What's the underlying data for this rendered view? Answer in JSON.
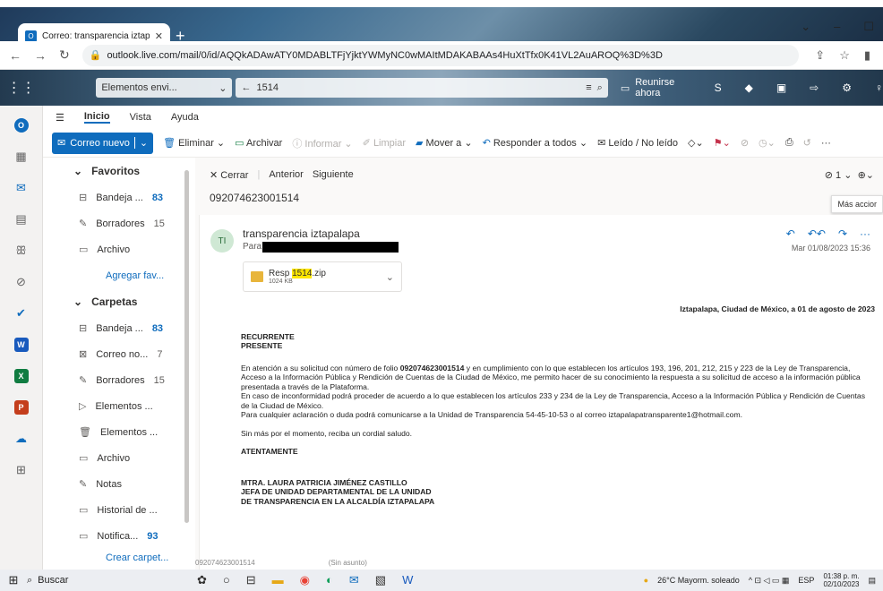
{
  "browser": {
    "tab_title": "Correo: transparencia iztapalapa",
    "url": "outlook.live.com/mail/0/id/AQQkADAwATY0MDABLTFjYjktYWMyNC0wMAItMDAKABAAs4HuXtTfx0K41VL2AuAROQ%3D%3D"
  },
  "header": {
    "folder": "Elementos envi...",
    "search": "1514",
    "meet": "Reunirse ahora"
  },
  "ribbon": {
    "tabs": [
      "Inicio",
      "Vista",
      "Ayuda"
    ],
    "new_mail": "Correo nuevo",
    "delete": "Eliminar",
    "archive": "Archivar",
    "report": "Informar",
    "sweep": "Limpiar",
    "move": "Mover a",
    "reply_all": "Responder a todos",
    "read_unread": "Leído / No leído"
  },
  "folders": {
    "favorites_header": "Favoritos",
    "favorites": [
      {
        "label": "Bandeja ...",
        "count": "83",
        "unread": true
      },
      {
        "label": "Borradores",
        "count": "15",
        "unread": false
      },
      {
        "label": "Archivo",
        "count": "",
        "unread": false
      }
    ],
    "add_favorite": "Agregar fav...",
    "folders_header": "Carpetas",
    "items": [
      {
        "label": "Bandeja ...",
        "count": "83",
        "unread": true
      },
      {
        "label": "Correo no...",
        "count": "7",
        "unread": false
      },
      {
        "label": "Borradores",
        "count": "15",
        "unread": false
      },
      {
        "label": "Elementos ...",
        "count": "",
        "unread": false
      },
      {
        "label": "Elementos ...",
        "count": "",
        "unread": false
      },
      {
        "label": "Archivo",
        "count": "",
        "unread": false
      },
      {
        "label": "Notas",
        "count": "",
        "unread": false
      },
      {
        "label": "Historial de ...",
        "count": "",
        "unread": false
      },
      {
        "label": "Notifica...",
        "count": "93",
        "unread": true
      }
    ],
    "create_folder": "Crear carpet..."
  },
  "reading": {
    "close": "Cerrar",
    "previous": "Anterior",
    "next": "Siguiente",
    "subject": "092074623001514",
    "attach_count": "1",
    "tooltip": "Más accior",
    "sender_initials": "TI",
    "sender": "transparencia iztapalapa",
    "to_label": "Para:",
    "date": "Mar 01/08/2023 15:36",
    "attachment": {
      "prefix": "Resp ",
      "highlight": "1514",
      "suffix": ".zip",
      "size": "1024 KB"
    }
  },
  "email": {
    "place_date": "Iztapalapa, Ciudad de México, a 01 de agosto de 2023",
    "recipient1": "RECURRENTE",
    "recipient2": "PRESENTE",
    "p1a": "En atención a su solicitud con número de folio ",
    "folio": "092074623001514",
    "p1b": " y en cumplimiento con lo que establecen los artículos 193, 196, 201, 212, 215 y 223 de la Ley de Transparencia, Acceso a la Información Pública y Rendición de Cuentas de la Ciudad de México, me permito hacer de su conocimiento la respuesta a su solicitud de acceso a la información pública presentada a través de la Plataforma.",
    "p2": "En caso de inconformidad podrá proceder de acuerdo a lo que establecen los artículos 233 y 234 de la Ley de Transparencia, Acceso a la Información Pública y Rendición de Cuentas de la Ciudad de México.",
    "p3": "Para cualquier aclaración o duda podrá comunicarse a la Unidad de Transparencia 54-45-10-53 o al correo iztapalapatransparente1@hotmail.com.",
    "closing": "Sin más por el momento, reciba un cordial saludo.",
    "regards": "ATENTAMENTE",
    "sig1": "MTRA. LAURA PATRICIA JIMÉNEZ CASTILLO",
    "sig2": "JEFA DE UNIDAD DEPARTAMENTAL DE LA UNIDAD",
    "sig3": "DE TRANSPARENCIA EN LA ALCALDÍA IZTAPALAPA"
  },
  "bottom_tabs": [
    "092074623001514",
    "(Sin asunto)"
  ],
  "taskbar": {
    "search": "Buscar",
    "weather": "26°C  Mayorm. soleado",
    "lang": "ESP",
    "time": "01:38 p. m.",
    "date": "02/10/2023"
  }
}
